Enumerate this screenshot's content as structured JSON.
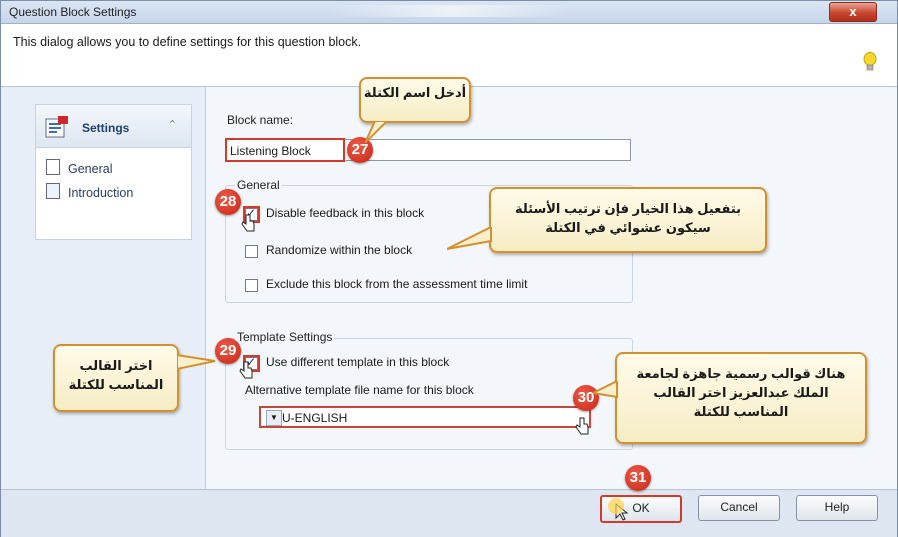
{
  "window": {
    "title": "Question Block Settings",
    "close_label": "x"
  },
  "info": {
    "description": "This dialog allows you to define settings for this question block."
  },
  "sidebar": {
    "section_label": "Settings",
    "items": [
      {
        "label": "General"
      },
      {
        "label": "Introduction"
      }
    ]
  },
  "form": {
    "block_name_label": "Block name:",
    "block_name_value": "Listening Block",
    "general_label": "General",
    "disable_feedback": "Disable feedback in this block",
    "randomize": "Randomize within the block",
    "exclude_time": "Exclude this block from the assessment time limit",
    "template_settings_label": "Template Settings",
    "use_different_template": "Use different template in this block",
    "alt_template_label": "Alternative template file name for this block",
    "template_value": "KAU-ENGLISH"
  },
  "buttons": {
    "ok": "OK",
    "cancel": "Cancel",
    "help": "Help"
  },
  "badges": {
    "b27": "27",
    "b28": "28",
    "b29": "29",
    "b30": "30",
    "b31": "31"
  },
  "callouts": {
    "enter_name": "أدخل اسم الكتلة",
    "randomize_note": "بتفعيل هذا الخيار فإن ترتيب الأسئلة سيكون عشوائي في الكتلة",
    "choose_template": "اختر القالب المناسب للكتلة",
    "official_templates": "هناك قوالب رسمية جاهزة لجامعة الملك عبدالعزيز اختر القالب المناسب للكتلة"
  },
  "colors": {
    "accent_red": "#d23a2c",
    "callout_border": "#d2902f",
    "link_blue": "#1f3f73"
  }
}
